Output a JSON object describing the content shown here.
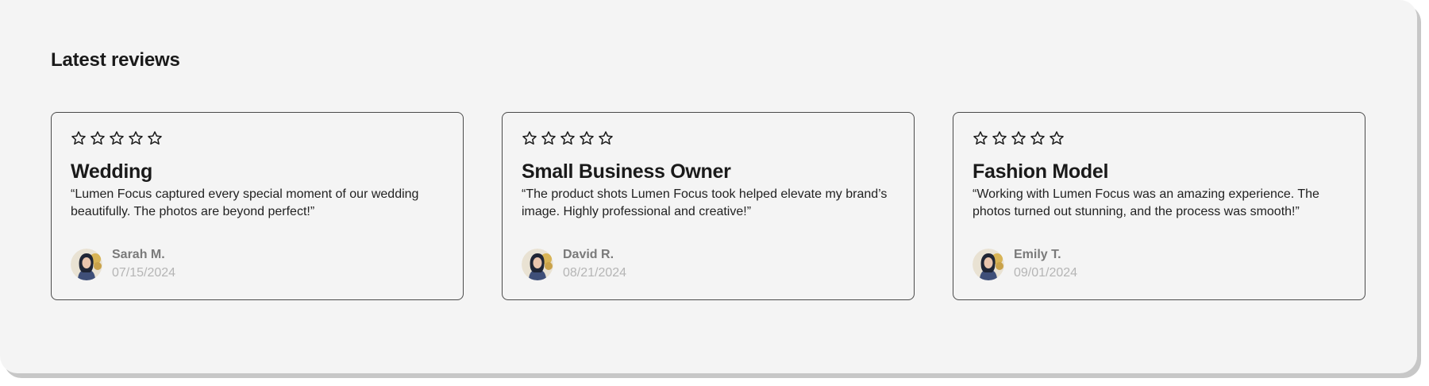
{
  "section": {
    "title": "Latest reviews"
  },
  "reviews": [
    {
      "title": "Wedding",
      "quote": "“Lumen Focus captured every special moment of our wedding beautifully. The photos are beyond perfect!”",
      "author": "Sarah M.",
      "date": "07/15/2024",
      "stars": 5
    },
    {
      "title": "Small Business Owner",
      "quote": "“The product shots Lumen Focus took helped elevate my brand’s image. Highly professional and creative!”",
      "author": "David R.",
      "date": "08/21/2024",
      "stars": 5
    },
    {
      "title": "Fashion Model",
      "quote": "“Working with Lumen Focus was an amazing experience. The photos turned out stunning, and the process was smooth!”",
      "author": "Emily T.",
      "date": "09/01/2024",
      "stars": 5
    }
  ],
  "icons": {
    "star": "star-outline-icon",
    "avatar": "user-avatar"
  },
  "colors": {
    "background": "#f4f4f4",
    "card_border": "#4a4a4a",
    "title_text": "#1a1a1a",
    "author_name": "#7a7a7a",
    "date_text": "#b5b5b5"
  }
}
